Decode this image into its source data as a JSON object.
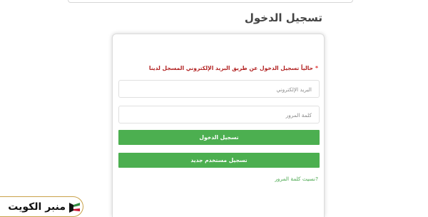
{
  "page": {
    "title": "تسجيل الدخول"
  },
  "form": {
    "notice_star": "*",
    "notice": "حالياً تسجيل الدخول عن طريق البريد الإلكتروني المسجل لدينا",
    "email_placeholder": "البريد الإلكتروني",
    "password_placeholder": "كلمة المرور",
    "login_label": "تسجيل الدخول",
    "register_label": "تسجيل مستخدم جديد",
    "forgot_label": "?نسيت كلمة المرور"
  },
  "watermark": {
    "text": "منبر الكويت",
    "icon": "kuwait-flag-icon"
  },
  "colors": {
    "button": "#4caf50",
    "notice": "#b22222",
    "link": "#4aa84f",
    "badge_border": "#c9a24a"
  }
}
